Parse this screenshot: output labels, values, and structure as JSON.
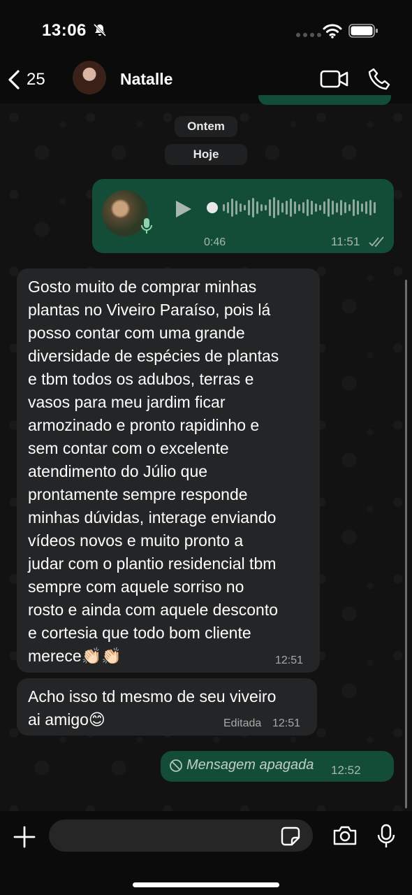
{
  "status_bar": {
    "time": "13:06"
  },
  "header": {
    "back_count": "25",
    "contact_name": "Natalle"
  },
  "dates": {
    "yesterday": "Ontem",
    "today": "Hoje"
  },
  "messages": [
    {
      "type": "voice",
      "direction": "out",
      "duration": "0:46",
      "time": "11:51",
      "status": "read"
    },
    {
      "type": "text",
      "direction": "in",
      "lines": [
        "Gosto muito de comprar minhas",
        "plantas no Viveiro Paraíso, pois lá",
        "posso contar com uma grande",
        "diversidade de espécies de plantas",
        "e tbm todos os adubos, terras e",
        "vasos para meu jardim ficar",
        "armozinado e pronto rapidinho e",
        "sem contar com o excelente",
        "atendimento do Júlio que",
        "prontamente sempre responde",
        "minhas dúvidas, interage enviando",
        "vídeos novos e muito pronto a",
        "judar com o plantio residencial tbm",
        "sempre com aquele sorriso no",
        "rosto e ainda com aquele desconto",
        "e cortesia que todo bom cliente",
        "merece👏🏻👏🏻"
      ],
      "time": "12:51"
    },
    {
      "type": "text",
      "direction": "in",
      "lines": [
        "Acho isso td mesmo de seu viveiro",
        "ai amigo😊"
      ],
      "edited_label": "Editada",
      "time": "12:51"
    },
    {
      "type": "deleted",
      "direction": "out",
      "text": "Mensagem apagada",
      "time": "12:52"
    }
  ],
  "colors": {
    "outgoing_bubble": "#144d37",
    "incoming_bubble": "#242526",
    "background": "#121212"
  },
  "icons": [
    "bell-slash-icon",
    "wifi-icon",
    "battery-icon",
    "back-chevron-icon",
    "video-camera-icon",
    "phone-icon",
    "play-icon",
    "microphone-icon",
    "read-receipt-icon",
    "deleted-icon",
    "plus-icon",
    "sticker-icon",
    "camera-icon"
  ]
}
